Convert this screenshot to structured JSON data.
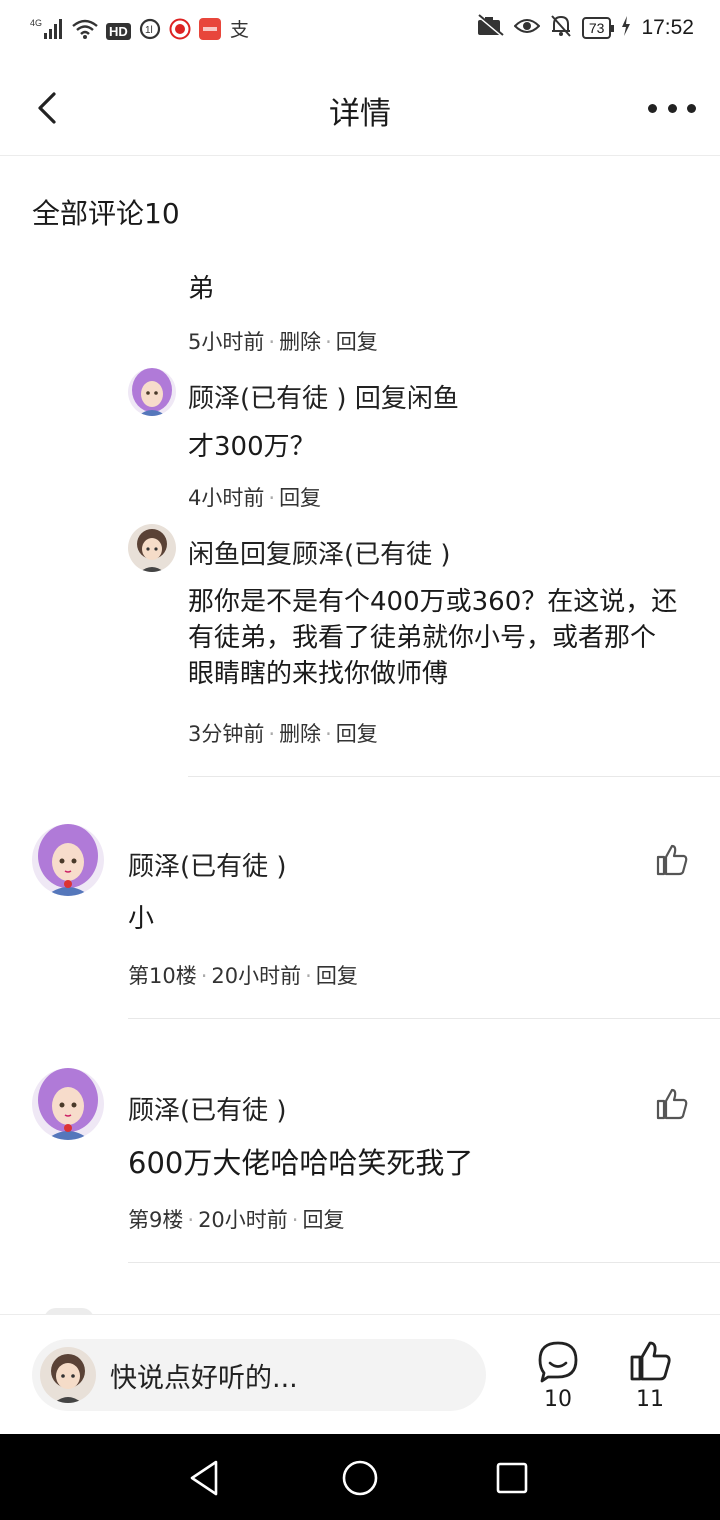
{
  "status_bar": {
    "network": "4G",
    "hd": "HD",
    "battery": "73",
    "time": "17:52",
    "alipay_icon": "支"
  },
  "header": {
    "title": "详情",
    "back_icon": "chevron-left-icon",
    "more_icon": "more-dots-icon"
  },
  "comments_header": "全部评论10",
  "replies": [
    {
      "name": "",
      "text": "弟",
      "time": "5小时前",
      "actions": [
        "删除",
        "回复"
      ]
    },
    {
      "name": "顾泽(已有徒 ) 回复闲鱼",
      "text": "才300万？",
      "time": "4小时前",
      "actions": [
        "回复"
      ]
    },
    {
      "name": "闲鱼回复顾泽(已有徒 )",
      "text": "那你是不是有个400万或360？在这说，还有徒弟，我看了徒弟就你小号，或者那个眼睛瞎的来找你做师傅",
      "time": "3分钟前",
      "actions": [
        "删除",
        "回复"
      ]
    }
  ],
  "comments": [
    {
      "name": "顾泽(已有徒 )",
      "text": "小",
      "floor": "第10楼",
      "time": "20小时前",
      "reply": "回复"
    },
    {
      "name": "顾泽(已有徒 )",
      "text": "600万大佬哈哈哈笑死我了",
      "floor": "第9楼",
      "time": "20小时前",
      "reply": "回复"
    }
  ],
  "bottom_bar": {
    "placeholder": "快说点好听的...",
    "comment_count": "10",
    "like_count": "11"
  },
  "colors": {
    "purple_hair": "#b07ad8",
    "brown_hair": "#5a4236",
    "divider": "#e8e8e8"
  }
}
